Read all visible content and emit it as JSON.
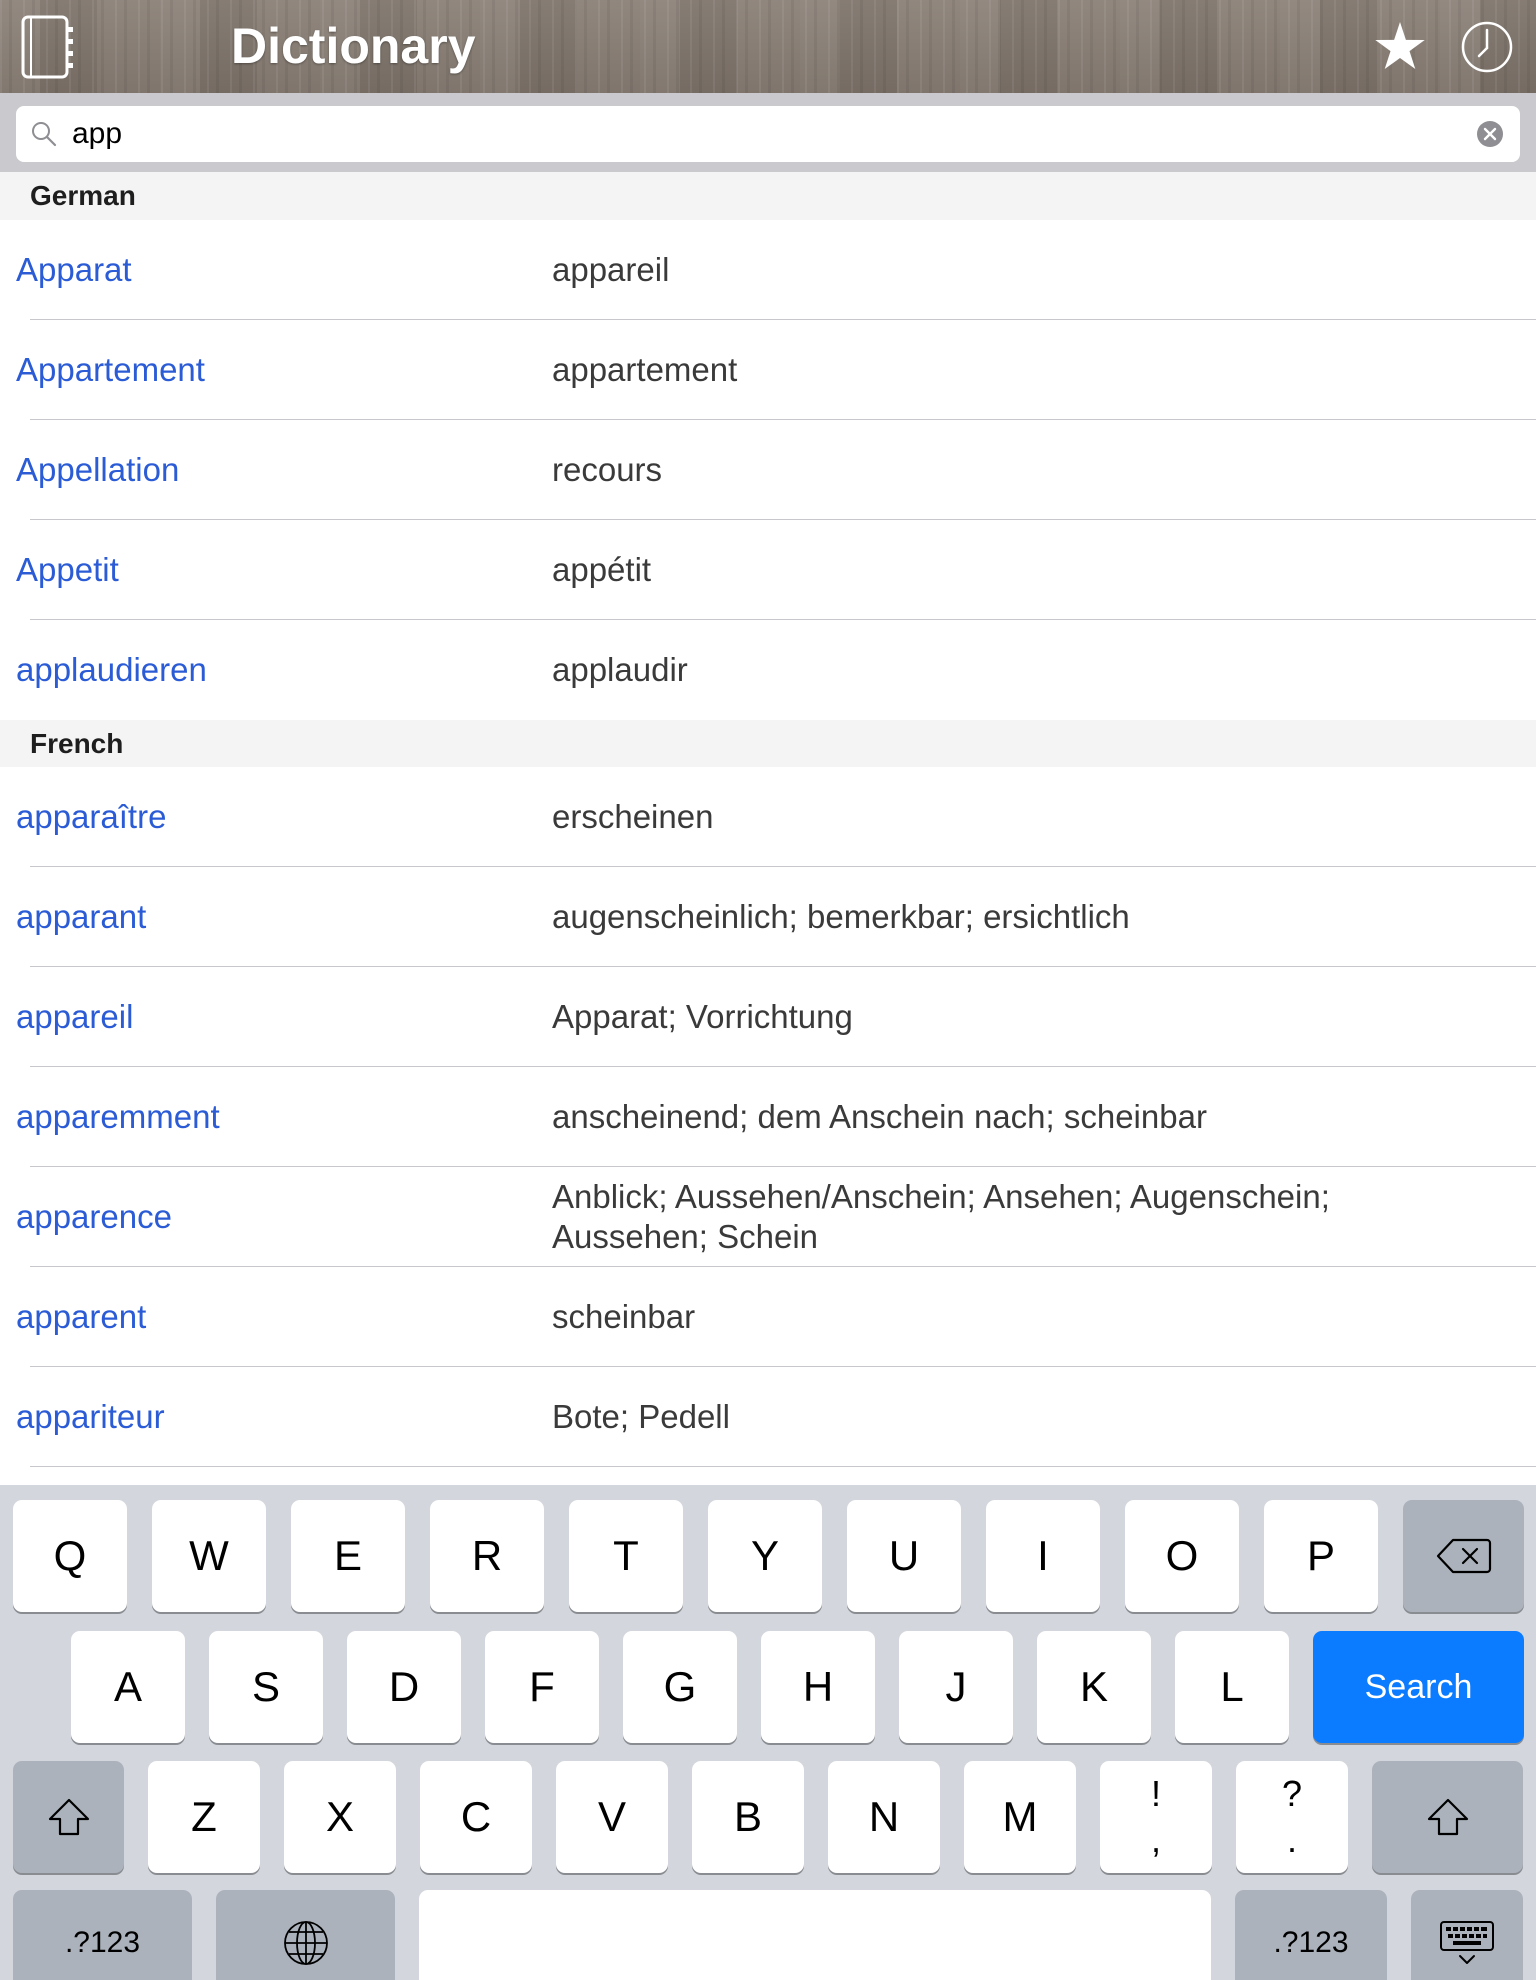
{
  "header": {
    "title": "Dictionary",
    "icons": {
      "left": "notebook-icon",
      "favorites": "star-icon",
      "history": "clock-icon"
    }
  },
  "search": {
    "value": "app",
    "icons": {
      "search": "search-icon",
      "clear": "clear-icon"
    }
  },
  "sections": [
    {
      "title": "German",
      "rows": [
        {
          "term": "Apparat",
          "translation": "appareil"
        },
        {
          "term": "Appartement",
          "translation": "appartement"
        },
        {
          "term": "Appellation",
          "translation": "recours"
        },
        {
          "term": "Appetit",
          "translation": "appétit"
        },
        {
          "term": "applaudieren",
          "translation": "applaudir"
        }
      ]
    },
    {
      "title": "French",
      "rows": [
        {
          "term": "apparaître",
          "translation": "erscheinen"
        },
        {
          "term": "apparant",
          "translation": "augenscheinlich; bemerkbar; ersichtlich"
        },
        {
          "term": "appareil",
          "translation": "Apparat; Vorrichtung"
        },
        {
          "term": "apparemment",
          "translation": "anscheinend; dem Anschein nach; scheinbar"
        },
        {
          "term": "apparence",
          "translation": "Anblick; Aussehen/Anschein; Ansehen; Augenschein; Aussehen; Schein"
        },
        {
          "term": "apparent",
          "translation": "scheinbar"
        },
        {
          "term": "appariteur",
          "translation": "Bote; Pedell"
        }
      ]
    }
  ],
  "keyboard": {
    "rows": [
      [
        "Q",
        "W",
        "E",
        "R",
        "T",
        "Y",
        "U",
        "I",
        "O",
        "P"
      ],
      [
        "A",
        "S",
        "D",
        "F",
        "G",
        "H",
        "J",
        "K",
        "L"
      ],
      [
        "Z",
        "X",
        "C",
        "V",
        "B",
        "N",
        "M"
      ]
    ],
    "punct_keys": [
      {
        "top": "!",
        "bottom": ","
      },
      {
        "top": "?",
        "bottom": "."
      }
    ],
    "search_label": "Search",
    "numbers_label": ".?123",
    "icons": {
      "backspace": "backspace-icon",
      "shift": "shift-icon",
      "globe": "globe-icon",
      "hide": "keyboard-hide-icon"
    }
  },
  "colors": {
    "term": "#2b5cd6",
    "translation": "#3a3a3a",
    "search_key": "#0b7bff",
    "header_text": "#ffffff",
    "keyboard_background": "#d3d6dc",
    "special_key": "#abb2bb"
  }
}
